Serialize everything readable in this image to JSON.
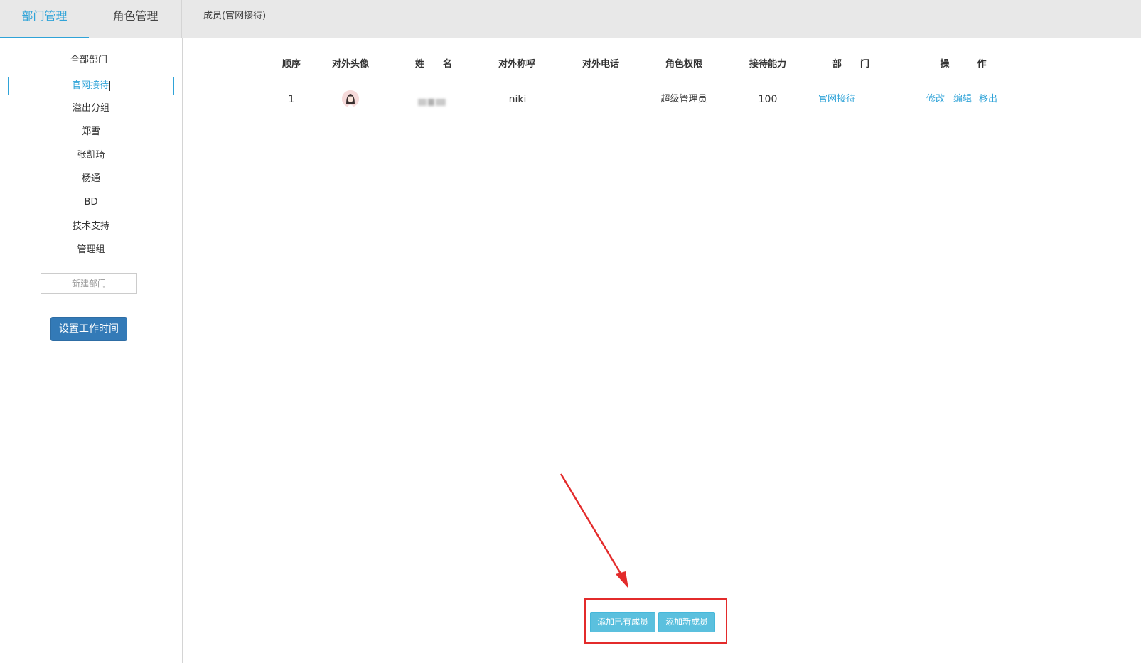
{
  "header": {
    "tabs": [
      {
        "label": "部门管理",
        "active": true
      },
      {
        "label": "角色管理",
        "active": false
      }
    ],
    "member_title": "成员(官网接待)"
  },
  "sidebar": {
    "items": [
      {
        "label": "全部部门"
      },
      {
        "label": "官网接待",
        "active": true
      },
      {
        "label": "溢出分组"
      },
      {
        "label": "郑雪"
      },
      {
        "label": "张凯琦"
      },
      {
        "label": "杨通"
      },
      {
        "label": "BD"
      },
      {
        "label": "技术支持"
      },
      {
        "label": "管理组"
      }
    ],
    "new_dept_placeholder": "新建部门",
    "worktime_button": "设置工作时间"
  },
  "table": {
    "headers": {
      "order": "顺序",
      "avatar": "对外头像",
      "name": "姓　　名",
      "nickname": "对外称呼",
      "phone": "对外电话",
      "role": "角色权限",
      "capacity": "接待能力",
      "dept": "部　　门",
      "ops": "操　　　作"
    },
    "rows": [
      {
        "order": "1",
        "nickname": "niki",
        "phone": "",
        "role": "超级管理员",
        "capacity": "100",
        "dept": "官网接待",
        "ops": [
          "修改",
          "编辑",
          "移出"
        ]
      }
    ]
  },
  "actions": {
    "add_existing": "添加已有成员",
    "add_new": "添加新成员"
  },
  "colors": {
    "accent": "#2fa3d8",
    "primary_button": "#337ab7",
    "info_button": "#5bc0de",
    "annotation": "#e32b2b",
    "topbar": "#e8e8e8"
  }
}
